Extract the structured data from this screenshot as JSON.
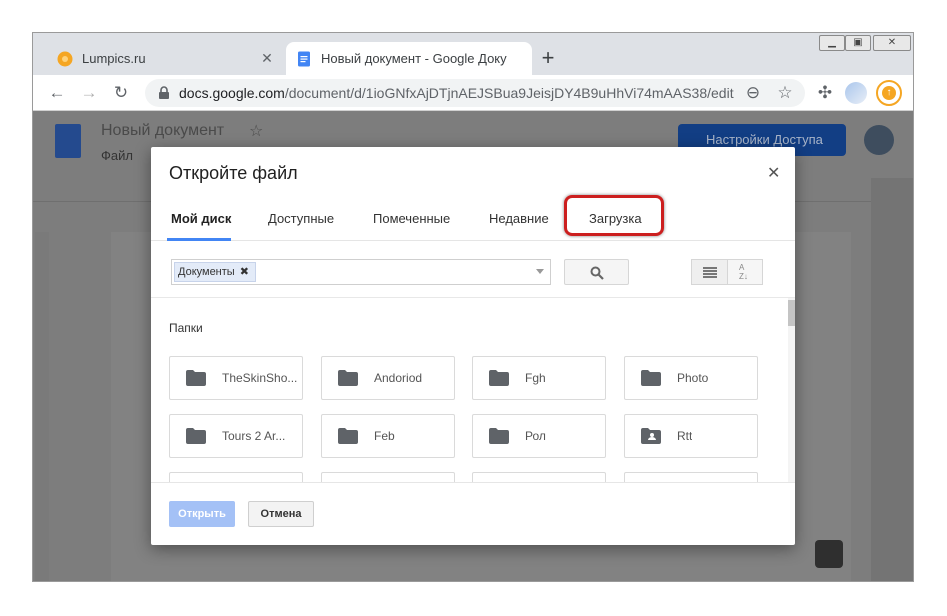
{
  "browser": {
    "tabs": [
      {
        "title": "Lumpics.ru",
        "active": false
      },
      {
        "title": "Новый документ - Google Доку",
        "active": true
      }
    ],
    "url_host": "docs.google.com",
    "url_path": "/document/d/1ioGNfxAjDTjnAEJSBua9JeisjDY4B9uHhVi74mAAS38/edit"
  },
  "docs": {
    "title": "Новый документ",
    "menu_file": "Файл",
    "share_label": "Настройки Доступа"
  },
  "dialog": {
    "title": "Откройте файл",
    "tabs": [
      "Мой диск",
      "Доступные",
      "Помеченные",
      "Недавние",
      "Загрузка"
    ],
    "filter_chip": "Документы",
    "section_label": "Папки",
    "folders": [
      {
        "name": "TheSkinSho...",
        "icon": "folder-icon"
      },
      {
        "name": "Andoriod",
        "icon": "folder-icon"
      },
      {
        "name": "Fgh",
        "icon": "folder-icon"
      },
      {
        "name": "Photo",
        "icon": "folder-icon"
      },
      {
        "name": "Tours 2 Ar...",
        "icon": "folder-icon"
      },
      {
        "name": "Feb",
        "icon": "folder-icon"
      },
      {
        "name": "Рол",
        "icon": "folder-icon"
      },
      {
        "name": "Rtt",
        "icon": "shared-folder-icon"
      }
    ],
    "open_label": "Открыть",
    "cancel_label": "Отмена"
  },
  "colors": {
    "accent": "#4285f4",
    "highlight": "#cc1f1f",
    "open_disabled": "#a4c1f6"
  }
}
